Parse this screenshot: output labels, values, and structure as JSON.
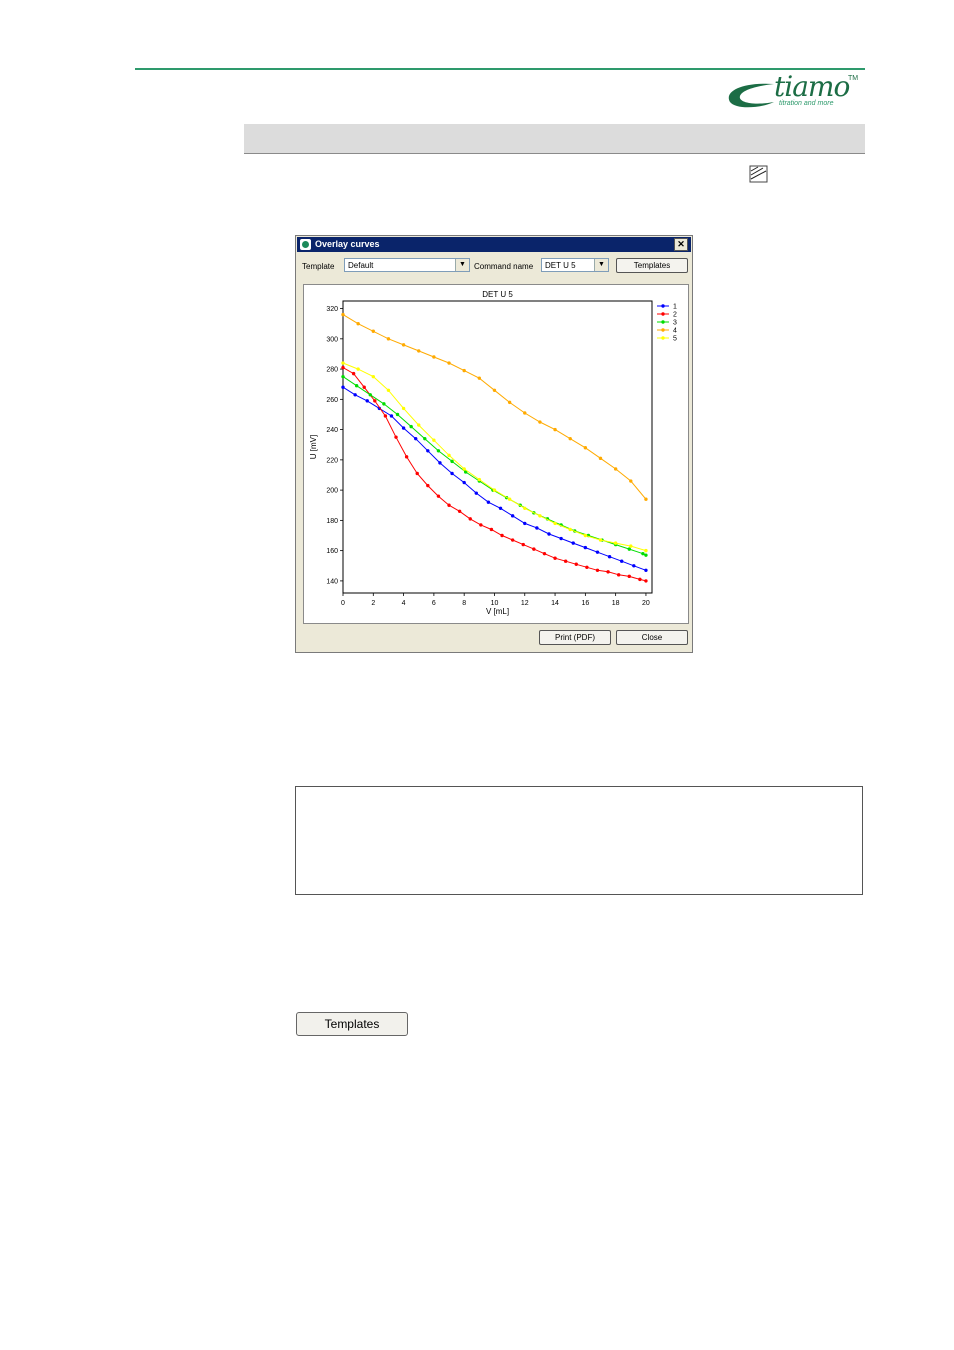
{
  "logo": {
    "word": "tiamo",
    "tm": "TM",
    "tagline": "titration and more"
  },
  "dialog": {
    "title": "Overlay curves",
    "close_glyph": "✕",
    "template_label": "Template",
    "template_value": "Default",
    "command_label": "Command name",
    "command_value": "DET U 5",
    "templates_button": "Templates",
    "print_button": "Print (PDF)",
    "close_button": "Close"
  },
  "chart_data": {
    "type": "line",
    "title": "DET U 5",
    "xlabel": "V [mL]",
    "ylabel": "U [mV]",
    "xlim": [
      0,
      20.4
    ],
    "ylim": [
      132,
      325
    ],
    "xticks": [
      0,
      2,
      4,
      6,
      8,
      10,
      12,
      14,
      16,
      18,
      20
    ],
    "yticks": [
      140,
      160,
      180,
      200,
      220,
      240,
      260,
      280,
      300,
      320
    ],
    "grid": false,
    "legend_position": "right",
    "series": [
      {
        "name": "1",
        "color": "#0000ff",
        "x": [
          0,
          0.8,
          1.6,
          2.4,
          3.2,
          4,
          4.8,
          5.6,
          6.4,
          7.2,
          8,
          8.8,
          9.6,
          10.4,
          11.2,
          12,
          12.8,
          13.6,
          14.4,
          15.2,
          16,
          16.8,
          17.6,
          18.4,
          19.2,
          20
        ],
        "y": [
          268,
          263,
          259,
          254,
          249,
          241,
          234,
          226,
          218,
          211,
          205,
          198,
          192,
          188,
          183,
          178,
          175,
          171,
          168,
          165,
          162,
          159,
          156,
          153,
          150,
          147
        ]
      },
      {
        "name": "2",
        "color": "#ff0000",
        "x": [
          0,
          0.7,
          1.4,
          2.1,
          2.8,
          3.5,
          4.2,
          4.9,
          5.6,
          6.3,
          7,
          7.7,
          8.4,
          9.1,
          9.8,
          10.5,
          11.2,
          11.9,
          12.6,
          13.3,
          14,
          14.7,
          15.4,
          16.1,
          16.8,
          17.5,
          18.2,
          18.9,
          19.6,
          20
        ],
        "y": [
          281,
          277,
          268,
          259,
          249,
          235,
          222,
          211,
          203,
          196,
          190,
          186,
          181,
          177,
          174,
          170,
          167,
          164,
          161,
          158,
          155,
          153,
          151,
          149,
          147,
          146,
          144,
          143,
          141,
          140
        ]
      },
      {
        "name": "3",
        "color": "#00dd00",
        "x": [
          0,
          0.9,
          1.8,
          2.7,
          3.6,
          4.5,
          5.4,
          6.3,
          7.2,
          8.1,
          9,
          9.9,
          10.8,
          11.7,
          12.6,
          13.5,
          14.4,
          15.3,
          16.2,
          17.1,
          18,
          18.9,
          19.8,
          20
        ],
        "y": [
          275,
          269,
          263,
          257,
          250,
          242,
          234,
          226,
          219,
          212,
          206,
          200,
          195,
          190,
          185,
          181,
          177,
          173,
          170,
          167,
          164,
          161,
          158,
          157
        ]
      },
      {
        "name": "4",
        "color": "#ffaa00",
        "x": [
          0,
          1,
          2,
          3,
          4,
          5,
          6,
          7,
          8,
          9,
          10,
          11,
          12,
          13,
          14,
          15,
          16,
          17,
          18,
          19,
          20
        ],
        "y": [
          316,
          310,
          305,
          300,
          296,
          292,
          288,
          284,
          279,
          274,
          266,
          258,
          251,
          245,
          240,
          234,
          228,
          221,
          214,
          206,
          194
        ]
      },
      {
        "name": "5",
        "color": "#ffff00",
        "x": [
          0,
          1,
          2,
          3,
          4,
          5,
          6,
          7,
          8,
          9,
          10,
          11,
          12,
          13,
          14,
          15,
          16,
          17,
          18,
          19,
          20
        ],
        "y": [
          284,
          280,
          275,
          266,
          254,
          243,
          233,
          223,
          214,
          207,
          200,
          194,
          188,
          183,
          178,
          174,
          170,
          167,
          165,
          163,
          160
        ]
      }
    ]
  },
  "templates_button_large": "Templates"
}
